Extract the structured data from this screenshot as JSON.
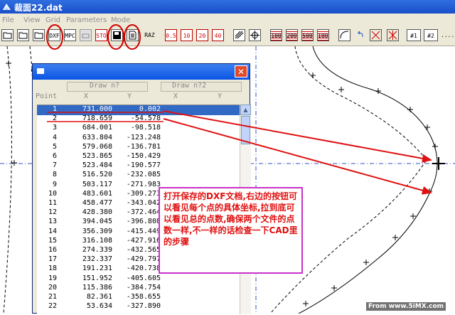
{
  "window": {
    "title": "裁面22.dat"
  },
  "menu": [
    "File",
    "View",
    "Grid",
    "Parameters",
    "Mode"
  ],
  "toolbar_labels": {
    "dxf": "DXF",
    "mpc": "MPC",
    "stop": "STO",
    "raz": "RAZ",
    "r1": "0.5",
    "r2": "10",
    "r3": "20",
    "r4": "40",
    "grid1": "100",
    "grid2": "200",
    "grid3": "500",
    "grid4": "1000",
    "hash1": "#1",
    "hash2": "#2",
    "more": "...."
  },
  "dialog": {
    "close_glyph": "✕",
    "group1": "Draw  n?",
    "group2": "Draw  n?2",
    "col_point": "Point",
    "col_x1": "X",
    "col_y1": "Y",
    "col_x2": "X",
    "col_y2": "Y",
    "scroll_up": "▲",
    "rows": [
      {
        "n": "1",
        "x": "731.000",
        "y": "0.002",
        "selected": true
      },
      {
        "n": "2",
        "x": "718.659",
        "y": "-54.578"
      },
      {
        "n": "3",
        "x": "684.001",
        "y": "-98.518"
      },
      {
        "n": "4",
        "x": "633.804",
        "y": "-123.248"
      },
      {
        "n": "5",
        "x": "579.068",
        "y": "-136.781"
      },
      {
        "n": "6",
        "x": "523.865",
        "y": "-150.429"
      },
      {
        "n": "7",
        "x": "523.484",
        "y": "-190.577"
      },
      {
        "n": "8",
        "x": "516.520",
        "y": "-232.085"
      },
      {
        "n": "9",
        "x": "503.117",
        "y": "-271.983"
      },
      {
        "n": "10",
        "x": "483.601",
        "y": "-309.273"
      },
      {
        "n": "11",
        "x": "458.477",
        "y": "-343.042"
      },
      {
        "n": "12",
        "x": "428.380",
        "y": "-372.464"
      },
      {
        "n": "13",
        "x": "394.045",
        "y": "-396.808"
      },
      {
        "n": "14",
        "x": "356.309",
        "y": "-415.449"
      },
      {
        "n": "15",
        "x": "316.108",
        "y": "-427.916"
      },
      {
        "n": "16",
        "x": "274.339",
        "y": "-432.565"
      },
      {
        "n": "17",
        "x": "232.337",
        "y": "-429.797"
      },
      {
        "n": "18",
        "x": "191.231",
        "y": "-420.738"
      },
      {
        "n": "19",
        "x": "151.952",
        "y": "-405.605"
      },
      {
        "n": "20",
        "x": "115.386",
        "y": "-384.754"
      },
      {
        "n": "21",
        "x": "82.361",
        "y": "-358.655"
      },
      {
        "n": "22",
        "x": "53.634",
        "y": "-327.890"
      }
    ]
  },
  "annotation": {
    "text": "打开保存的DXF文档,右边的按钮可以看见每个点的具体坐标,拉到底可以看见总的点数,确保两个文件的点数一样,不一样的话检查一下CAD里的步骤"
  },
  "watermark": "From www.5iMX.com",
  "colors": {
    "titlebar": "#1a4fc8",
    "highlight_circle": "#d00000",
    "arrow": "#e01010",
    "note_border": "#c833c8",
    "selection": "#316ac5"
  }
}
